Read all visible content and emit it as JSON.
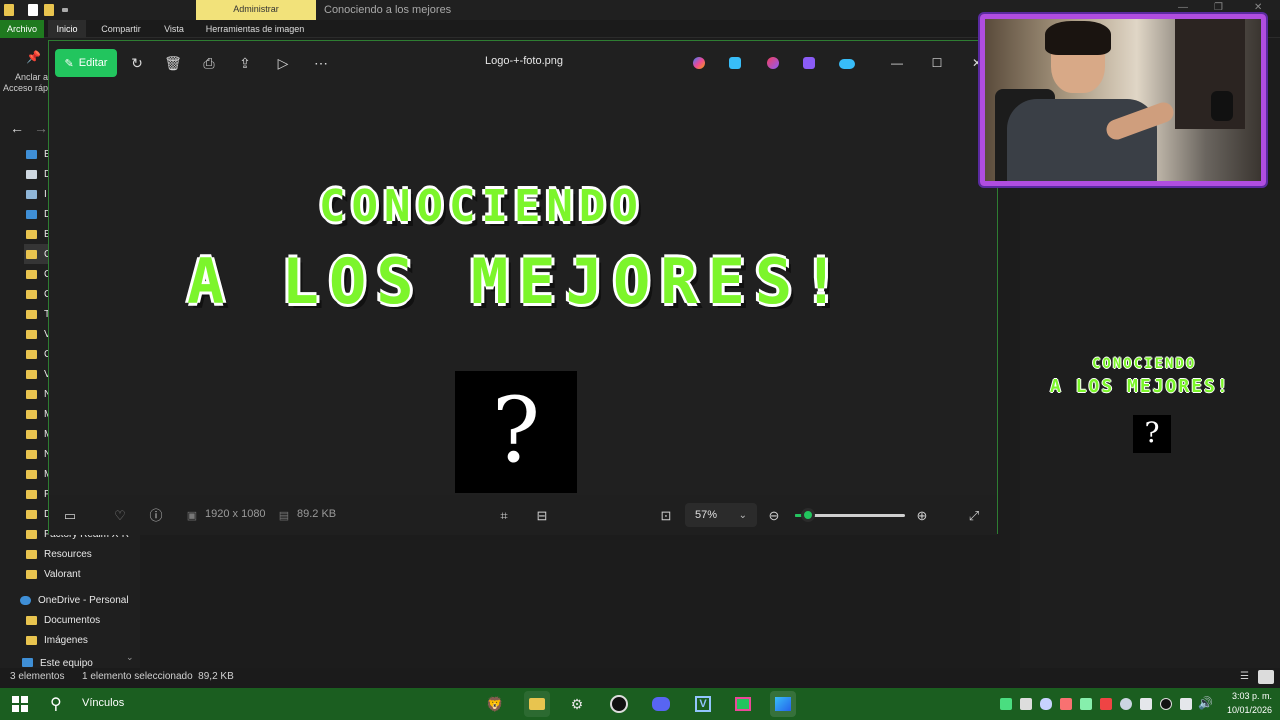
{
  "explorer": {
    "admin_tab": "Administrar",
    "window_title": "Conociendo a los mejores",
    "ribbon_tabs": [
      "Archivo",
      "Inicio",
      "Compartir",
      "Vista",
      "Herramientas de imagen"
    ],
    "pin_label_1": "Anclar a",
    "pin_label_2": "Acceso ráp",
    "nav_letters": [
      "E",
      "D",
      "I",
      "D",
      "E",
      "C",
      "C",
      "C",
      "T",
      "V",
      "C",
      "V",
      "N",
      "M",
      "M",
      "N",
      "M",
      "P",
      "D"
    ],
    "nav_named": {
      "factory": "Factory Realm X-R",
      "resources": "Resources",
      "valorant": "Valorant",
      "onedrive": "OneDrive - Personal",
      "documentos": "Documentos",
      "imagenes": "Imágenes",
      "este_equipo": "Este equipo"
    },
    "status": {
      "count": "3 elementos",
      "selected": "1 elemento seleccionado  89,2 KB"
    }
  },
  "viewer": {
    "edit_label": "Editar",
    "file_title": "Logo-+-foto.png",
    "logo_line1": "CONOCIENDO",
    "logo_line2": "A LOS MEJORES!",
    "question_mark": "?",
    "dimensions": "1920 x 1080",
    "file_size": "89.2 KB",
    "zoom_label": "57%",
    "zoom_level": 0.12
  },
  "preview": {
    "line1": "CONOCIENDO",
    "line2": "A LOS MEJORES!",
    "question_mark": "?"
  },
  "taskbar": {
    "search_label": "Vínculos",
    "time": "3:03 p. m.",
    "date": "10/01/2026"
  },
  "colors": {
    "accent_green": "#22c55e",
    "logo_green": "#7cf52b",
    "taskbar_green": "#1b5e20",
    "webcam_border": "#b04de0"
  }
}
